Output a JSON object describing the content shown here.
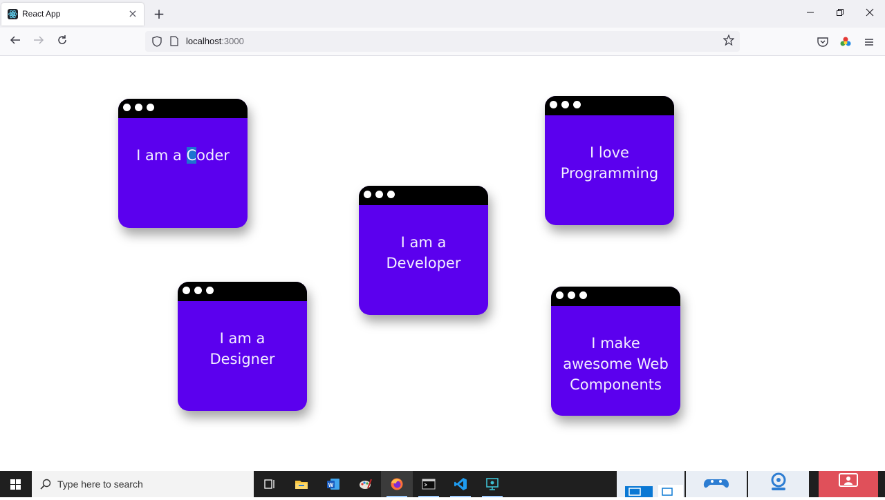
{
  "browser": {
    "tab_title": "React App",
    "tab_close": "×",
    "new_tab": "+",
    "url_host": "localhost",
    "url_port": ":3000",
    "window_controls": {
      "minimize": "—",
      "maximize": "❐",
      "close": "✕"
    },
    "nav": {
      "back": "←",
      "forward": "→",
      "reload": "↻",
      "bookmark": "☆",
      "menu": "≡"
    }
  },
  "cards": [
    {
      "lines": [
        "I am a ",
        "C",
        "oder"
      ]
    },
    {
      "lines": [
        "I love",
        "Programming"
      ]
    },
    {
      "lines": [
        "I am a",
        "Developer"
      ]
    },
    {
      "lines": [
        "I am a",
        "Designer"
      ]
    },
    {
      "lines": [
        "I make",
        "awesome Web",
        "Components"
      ]
    }
  ],
  "colors": {
    "card": "#5b00ee",
    "card_bar": "#000000",
    "highlight": "#1e73d0"
  },
  "taskbar": {
    "search_placeholder": "Type here to search",
    "pinned": [
      "task-view-icon",
      "file-explorer-icon",
      "word-icon",
      "paint-icon",
      "firefox-icon",
      "terminal-icon",
      "vscode-icon",
      "remote-desktop-icon"
    ]
  }
}
